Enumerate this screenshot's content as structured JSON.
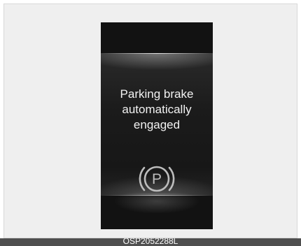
{
  "display": {
    "message": "Parking brake\nautomatically\nengaged",
    "icon": "parking-brake-icon",
    "icon_letter": "P"
  },
  "caption": {
    "code": "OSP2052288L"
  },
  "colors": {
    "frame_background": "#efefef",
    "display_background": "#121212",
    "text": "#f2f2f2",
    "caption_bar": "#4f4f4f"
  }
}
